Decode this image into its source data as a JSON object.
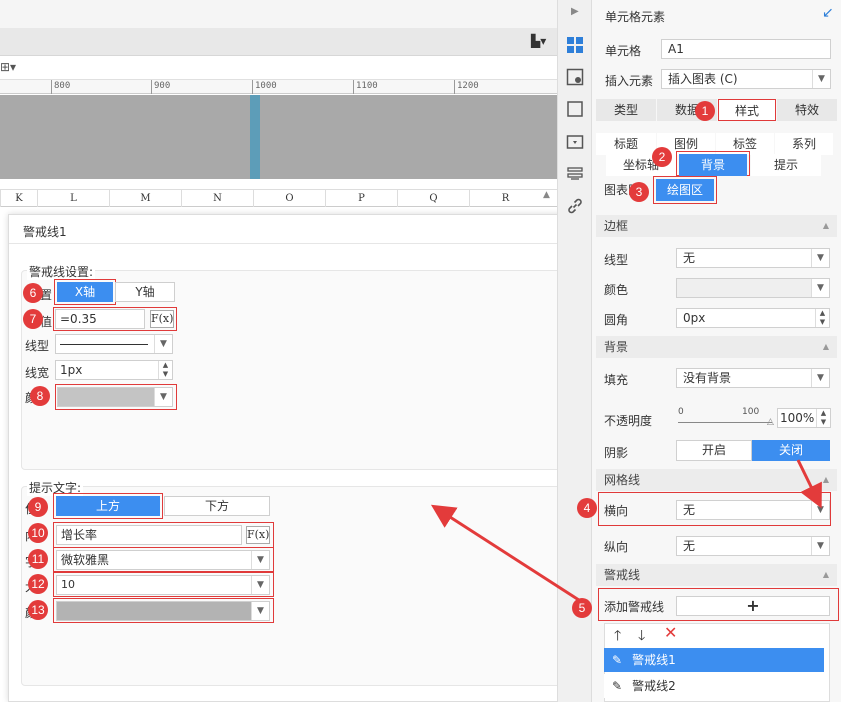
{
  "sheet": {
    "ruler_ticks": [
      "800",
      "900",
      "1000",
      "1100",
      "1200"
    ],
    "columns": [
      "K",
      "L",
      "M",
      "N",
      "O",
      "P",
      "Q",
      "R"
    ]
  },
  "dialog": {
    "title": "警戒线1",
    "settings": {
      "group_label": "警戒线设置:",
      "pos_label_partial": "置",
      "x_axis": "X轴",
      "y_axis": "Y轴",
      "value_label_partial": "值",
      "value": "=0.35",
      "fx": "F(x)",
      "line_type_label": "线型",
      "line_width_label": "线宽",
      "line_width_value": "1px",
      "color_label_partial": "颜"
    },
    "tip": {
      "group_label": "提示文字:",
      "pos_label_partial": "位",
      "above": "上方",
      "below": "下方",
      "content_label_partial": "内",
      "content": "增长率",
      "fx": "F(x)",
      "font_label_partial": "字",
      "font": "微软雅黑",
      "size_label_partial": "大",
      "size": "10",
      "color_label_partial": "颜"
    }
  },
  "panel": {
    "title": "单元格元素",
    "cell_label": "单元格",
    "cell_value": "A1",
    "insert_label": "插入元素",
    "insert_value": "插入图表 (C)",
    "main_tabs": [
      "类型",
      "数据",
      "样式",
      "特效"
    ],
    "sub_tabs_row1": [
      "标题",
      "图例",
      "标签",
      "系列"
    ],
    "sub_tabs_row2": [
      "坐标轴",
      "背景",
      "提示"
    ],
    "sub_tabs_row3": [
      "图表区",
      "绘图区"
    ],
    "border_section": "边框",
    "line_type_label": "线型",
    "line_type_value": "无",
    "color_label": "颜色",
    "radius_label": "圆角",
    "radius_value": "0px",
    "background_section": "背景",
    "fill_label": "填充",
    "fill_value": "没有背景",
    "opacity_label": "不透明度",
    "opacity_min": "0",
    "opacity_max": "100",
    "opacity_value": "100%",
    "opacity_level": 1.0,
    "shadow_label": "阴影",
    "shadow_on": "开启",
    "shadow_off": "关闭",
    "grid_section": "网格线",
    "horizontal_label": "横向",
    "horizontal_value": "无",
    "vertical_label": "纵向",
    "vertical_value": "无",
    "warn_section": "警戒线",
    "add_warn_label": "添加警戒线",
    "add_warn_button": "+",
    "warn_items": [
      "警戒线1",
      "警戒线2"
    ]
  },
  "badges": [
    "1",
    "2",
    "3",
    "4",
    "5",
    "6",
    "7",
    "8",
    "9",
    "10",
    "11",
    "12",
    "13"
  ],
  "colors": {
    "accent": "#3c8ef0",
    "annotation_red": "#e33b3b",
    "swatch_gray": "#c4c4c4"
  }
}
